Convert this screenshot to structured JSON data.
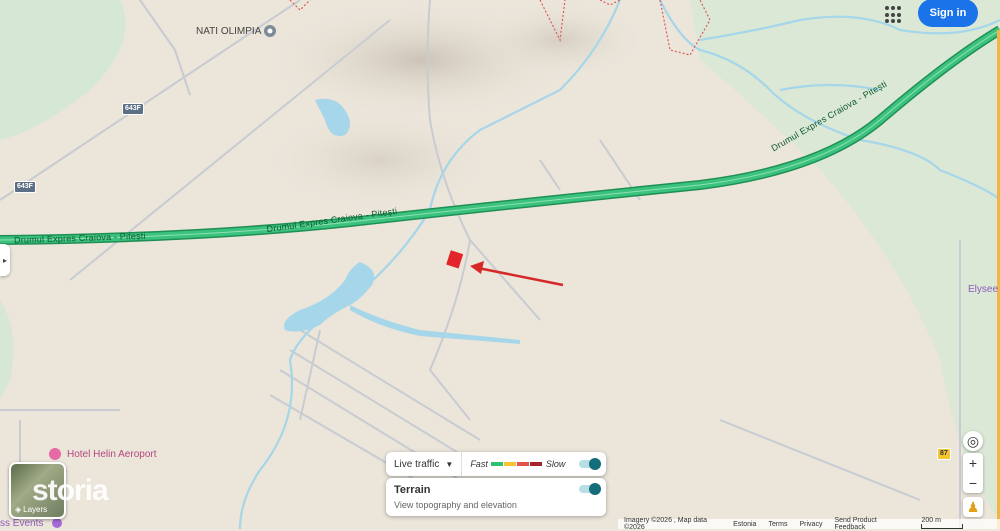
{
  "header": {
    "sign_in": "Sign in"
  },
  "map": {
    "road_label_1": "Drumul Expres Craiova - Pitești",
    "road_label_2": "Drumul Expres Craiova - Pitești",
    "road_label_3": "Drumul Expres Craiova - Pitești",
    "shields": [
      "643F",
      "643F",
      "87"
    ],
    "places": {
      "nati": "NATI OLIMPIA",
      "hotel": "Hotel Helin Aeroport",
      "elysee": "Elysee",
      "events": "ss Events"
    },
    "colors": {
      "expressway": "#34b36f",
      "water": "#9fd3e6",
      "marker": "#e3242b"
    }
  },
  "traffic": {
    "label": "Live traffic",
    "fast": "Fast",
    "slow": "Slow",
    "colors": [
      "#2fbf71",
      "#f2c531",
      "#e2514a",
      "#a3232f"
    ]
  },
  "terrain": {
    "title": "Terrain",
    "subtitle": "View topography and elevation"
  },
  "layers": {
    "label": "Layers"
  },
  "watermark": "storia",
  "footer": {
    "imagery": "Imagery ©2026 , Map data ©2026",
    "country": "Estonia",
    "terms": "Terms",
    "privacy": "Privacy",
    "feedback": "Send Product Feedback",
    "scale": "200 m"
  },
  "icons": [
    "apps-grid-icon",
    "chevron-right-icon",
    "dropdown-arrow-icon",
    "layers-icon",
    "my-location-icon",
    "zoom-in-icon",
    "zoom-out-icon",
    "pegman-icon",
    "place-pin-icon",
    "hotel-icon"
  ]
}
